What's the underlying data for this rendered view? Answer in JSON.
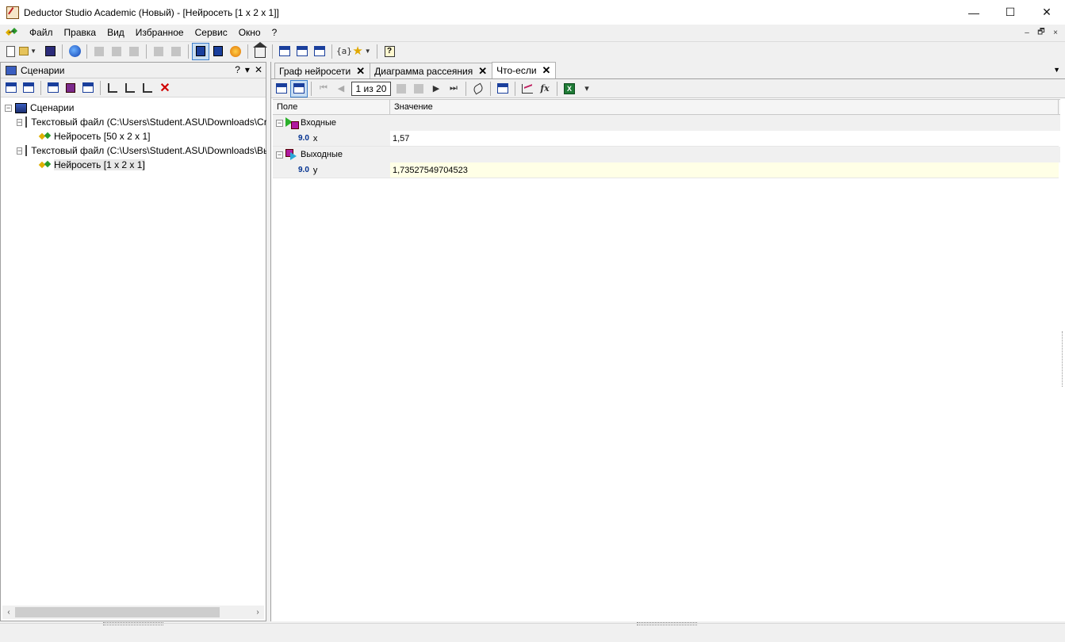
{
  "window": {
    "title": "Deductor Studio Academic (Новый) - [Нейросеть [1 x 2 x 1]]",
    "minimize": "—",
    "maximize": "☐",
    "close": "✕"
  },
  "menu": {
    "items": [
      "Файл",
      "Правка",
      "Вид",
      "Избранное",
      "Сервис",
      "Окно",
      "?"
    ],
    "mdi_minimize": "–",
    "mdi_restore": "🗗",
    "mdi_close": "×"
  },
  "toolbar": {
    "icons": [
      "new-document-icon",
      "open-folder-icon",
      "save-icon",
      "connect-icon",
      "cut-icon",
      "copy-icon",
      "paste-icon",
      "find-icon",
      "replace-icon",
      "scenarios-icon",
      "book-icon",
      "wizard-icon",
      "home-icon",
      "cascade-icon",
      "tile-horizontal-icon",
      "tile-vertical-icon",
      "variables-icon",
      "favorites-icon",
      "help-icon"
    ],
    "variables_label": "{a}",
    "star": "★",
    "help": "?"
  },
  "left_panel": {
    "title": "Сценарии",
    "help": "?",
    "dropdown": "▾",
    "close": "✕",
    "delete": "✕",
    "tree": [
      {
        "label": "Сценарии",
        "level": 0,
        "expanded": true
      },
      {
        "label": "Текстовый файл (C:\\Users\\Student.ASU\\Downloads\\Cre",
        "level": 1,
        "expanded": true
      },
      {
        "label": "Нейросеть [50 x 2 x 1]",
        "level": 2
      },
      {
        "label": "Текстовый файл (C:\\Users\\Student.ASU\\Downloads\\Вы",
        "level": 1,
        "expanded": true
      },
      {
        "label": "Нейросеть [1 x 2 x 1]",
        "level": 2,
        "selected": true
      }
    ],
    "scroll_left": "‹",
    "scroll_right": "›"
  },
  "tabs": [
    {
      "label": "Граф нейросети",
      "close": "✕"
    },
    {
      "label": "Диаграмма рассеяния",
      "close": "✕"
    },
    {
      "label": "Что-если",
      "close": "✕",
      "active": true
    }
  ],
  "tabs_dropdown": "▼",
  "data_toolbar": {
    "pager": "1 из 20",
    "first": "⏮",
    "prev": "◀",
    "next": "▶",
    "last": "⏭",
    "fx": "fx",
    "excel": "X",
    "dropdown": "▾"
  },
  "grid": {
    "columns": [
      "Поле",
      "Значение"
    ],
    "groups": [
      {
        "name": "Входные",
        "rows": [
          {
            "type": "9.0",
            "field": "x",
            "value": "1,57"
          }
        ]
      },
      {
        "name": "Выходные",
        "rows": [
          {
            "type": "9.0",
            "field": "y",
            "value": "1,73527549704523"
          }
        ]
      }
    ]
  },
  "colors": {
    "accent": "#3d7fcc",
    "highlight_row": "#ffffe6",
    "type_badge": "#00308f"
  }
}
